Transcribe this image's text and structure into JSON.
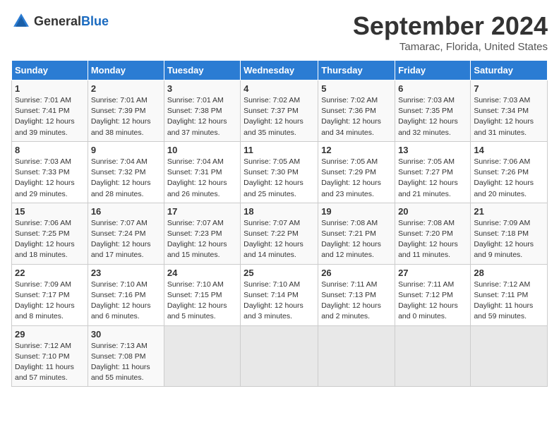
{
  "logo": {
    "text_general": "General",
    "text_blue": "Blue"
  },
  "title": "September 2024",
  "subtitle": "Tamarac, Florida, United States",
  "days_of_week": [
    "Sunday",
    "Monday",
    "Tuesday",
    "Wednesday",
    "Thursday",
    "Friday",
    "Saturday"
  ],
  "weeks": [
    [
      {
        "day": "1",
        "detail": "Sunrise: 7:01 AM\nSunset: 7:41 PM\nDaylight: 12 hours\nand 39 minutes."
      },
      {
        "day": "2",
        "detail": "Sunrise: 7:01 AM\nSunset: 7:39 PM\nDaylight: 12 hours\nand 38 minutes."
      },
      {
        "day": "3",
        "detail": "Sunrise: 7:01 AM\nSunset: 7:38 PM\nDaylight: 12 hours\nand 37 minutes."
      },
      {
        "day": "4",
        "detail": "Sunrise: 7:02 AM\nSunset: 7:37 PM\nDaylight: 12 hours\nand 35 minutes."
      },
      {
        "day": "5",
        "detail": "Sunrise: 7:02 AM\nSunset: 7:36 PM\nDaylight: 12 hours\nand 34 minutes."
      },
      {
        "day": "6",
        "detail": "Sunrise: 7:03 AM\nSunset: 7:35 PM\nDaylight: 12 hours\nand 32 minutes."
      },
      {
        "day": "7",
        "detail": "Sunrise: 7:03 AM\nSunset: 7:34 PM\nDaylight: 12 hours\nand 31 minutes."
      }
    ],
    [
      {
        "day": "8",
        "detail": "Sunrise: 7:03 AM\nSunset: 7:33 PM\nDaylight: 12 hours\nand 29 minutes."
      },
      {
        "day": "9",
        "detail": "Sunrise: 7:04 AM\nSunset: 7:32 PM\nDaylight: 12 hours\nand 28 minutes."
      },
      {
        "day": "10",
        "detail": "Sunrise: 7:04 AM\nSunset: 7:31 PM\nDaylight: 12 hours\nand 26 minutes."
      },
      {
        "day": "11",
        "detail": "Sunrise: 7:05 AM\nSunset: 7:30 PM\nDaylight: 12 hours\nand 25 minutes."
      },
      {
        "day": "12",
        "detail": "Sunrise: 7:05 AM\nSunset: 7:29 PM\nDaylight: 12 hours\nand 23 minutes."
      },
      {
        "day": "13",
        "detail": "Sunrise: 7:05 AM\nSunset: 7:27 PM\nDaylight: 12 hours\nand 21 minutes."
      },
      {
        "day": "14",
        "detail": "Sunrise: 7:06 AM\nSunset: 7:26 PM\nDaylight: 12 hours\nand 20 minutes."
      }
    ],
    [
      {
        "day": "15",
        "detail": "Sunrise: 7:06 AM\nSunset: 7:25 PM\nDaylight: 12 hours\nand 18 minutes."
      },
      {
        "day": "16",
        "detail": "Sunrise: 7:07 AM\nSunset: 7:24 PM\nDaylight: 12 hours\nand 17 minutes."
      },
      {
        "day": "17",
        "detail": "Sunrise: 7:07 AM\nSunset: 7:23 PM\nDaylight: 12 hours\nand 15 minutes."
      },
      {
        "day": "18",
        "detail": "Sunrise: 7:07 AM\nSunset: 7:22 PM\nDaylight: 12 hours\nand 14 minutes."
      },
      {
        "day": "19",
        "detail": "Sunrise: 7:08 AM\nSunset: 7:21 PM\nDaylight: 12 hours\nand 12 minutes."
      },
      {
        "day": "20",
        "detail": "Sunrise: 7:08 AM\nSunset: 7:20 PM\nDaylight: 12 hours\nand 11 minutes."
      },
      {
        "day": "21",
        "detail": "Sunrise: 7:09 AM\nSunset: 7:18 PM\nDaylight: 12 hours\nand 9 minutes."
      }
    ],
    [
      {
        "day": "22",
        "detail": "Sunrise: 7:09 AM\nSunset: 7:17 PM\nDaylight: 12 hours\nand 8 minutes."
      },
      {
        "day": "23",
        "detail": "Sunrise: 7:10 AM\nSunset: 7:16 PM\nDaylight: 12 hours\nand 6 minutes."
      },
      {
        "day": "24",
        "detail": "Sunrise: 7:10 AM\nSunset: 7:15 PM\nDaylight: 12 hours\nand 5 minutes."
      },
      {
        "day": "25",
        "detail": "Sunrise: 7:10 AM\nSunset: 7:14 PM\nDaylight: 12 hours\nand 3 minutes."
      },
      {
        "day": "26",
        "detail": "Sunrise: 7:11 AM\nSunset: 7:13 PM\nDaylight: 12 hours\nand 2 minutes."
      },
      {
        "day": "27",
        "detail": "Sunrise: 7:11 AM\nSunset: 7:12 PM\nDaylight: 12 hours\nand 0 minutes."
      },
      {
        "day": "28",
        "detail": "Sunrise: 7:12 AM\nSunset: 7:11 PM\nDaylight: 11 hours\nand 59 minutes."
      }
    ],
    [
      {
        "day": "29",
        "detail": "Sunrise: 7:12 AM\nSunset: 7:10 PM\nDaylight: 11 hours\nand 57 minutes."
      },
      {
        "day": "30",
        "detail": "Sunrise: 7:13 AM\nSunset: 7:08 PM\nDaylight: 11 hours\nand 55 minutes."
      },
      {
        "day": "",
        "detail": ""
      },
      {
        "day": "",
        "detail": ""
      },
      {
        "day": "",
        "detail": ""
      },
      {
        "day": "",
        "detail": ""
      },
      {
        "day": "",
        "detail": ""
      }
    ]
  ]
}
